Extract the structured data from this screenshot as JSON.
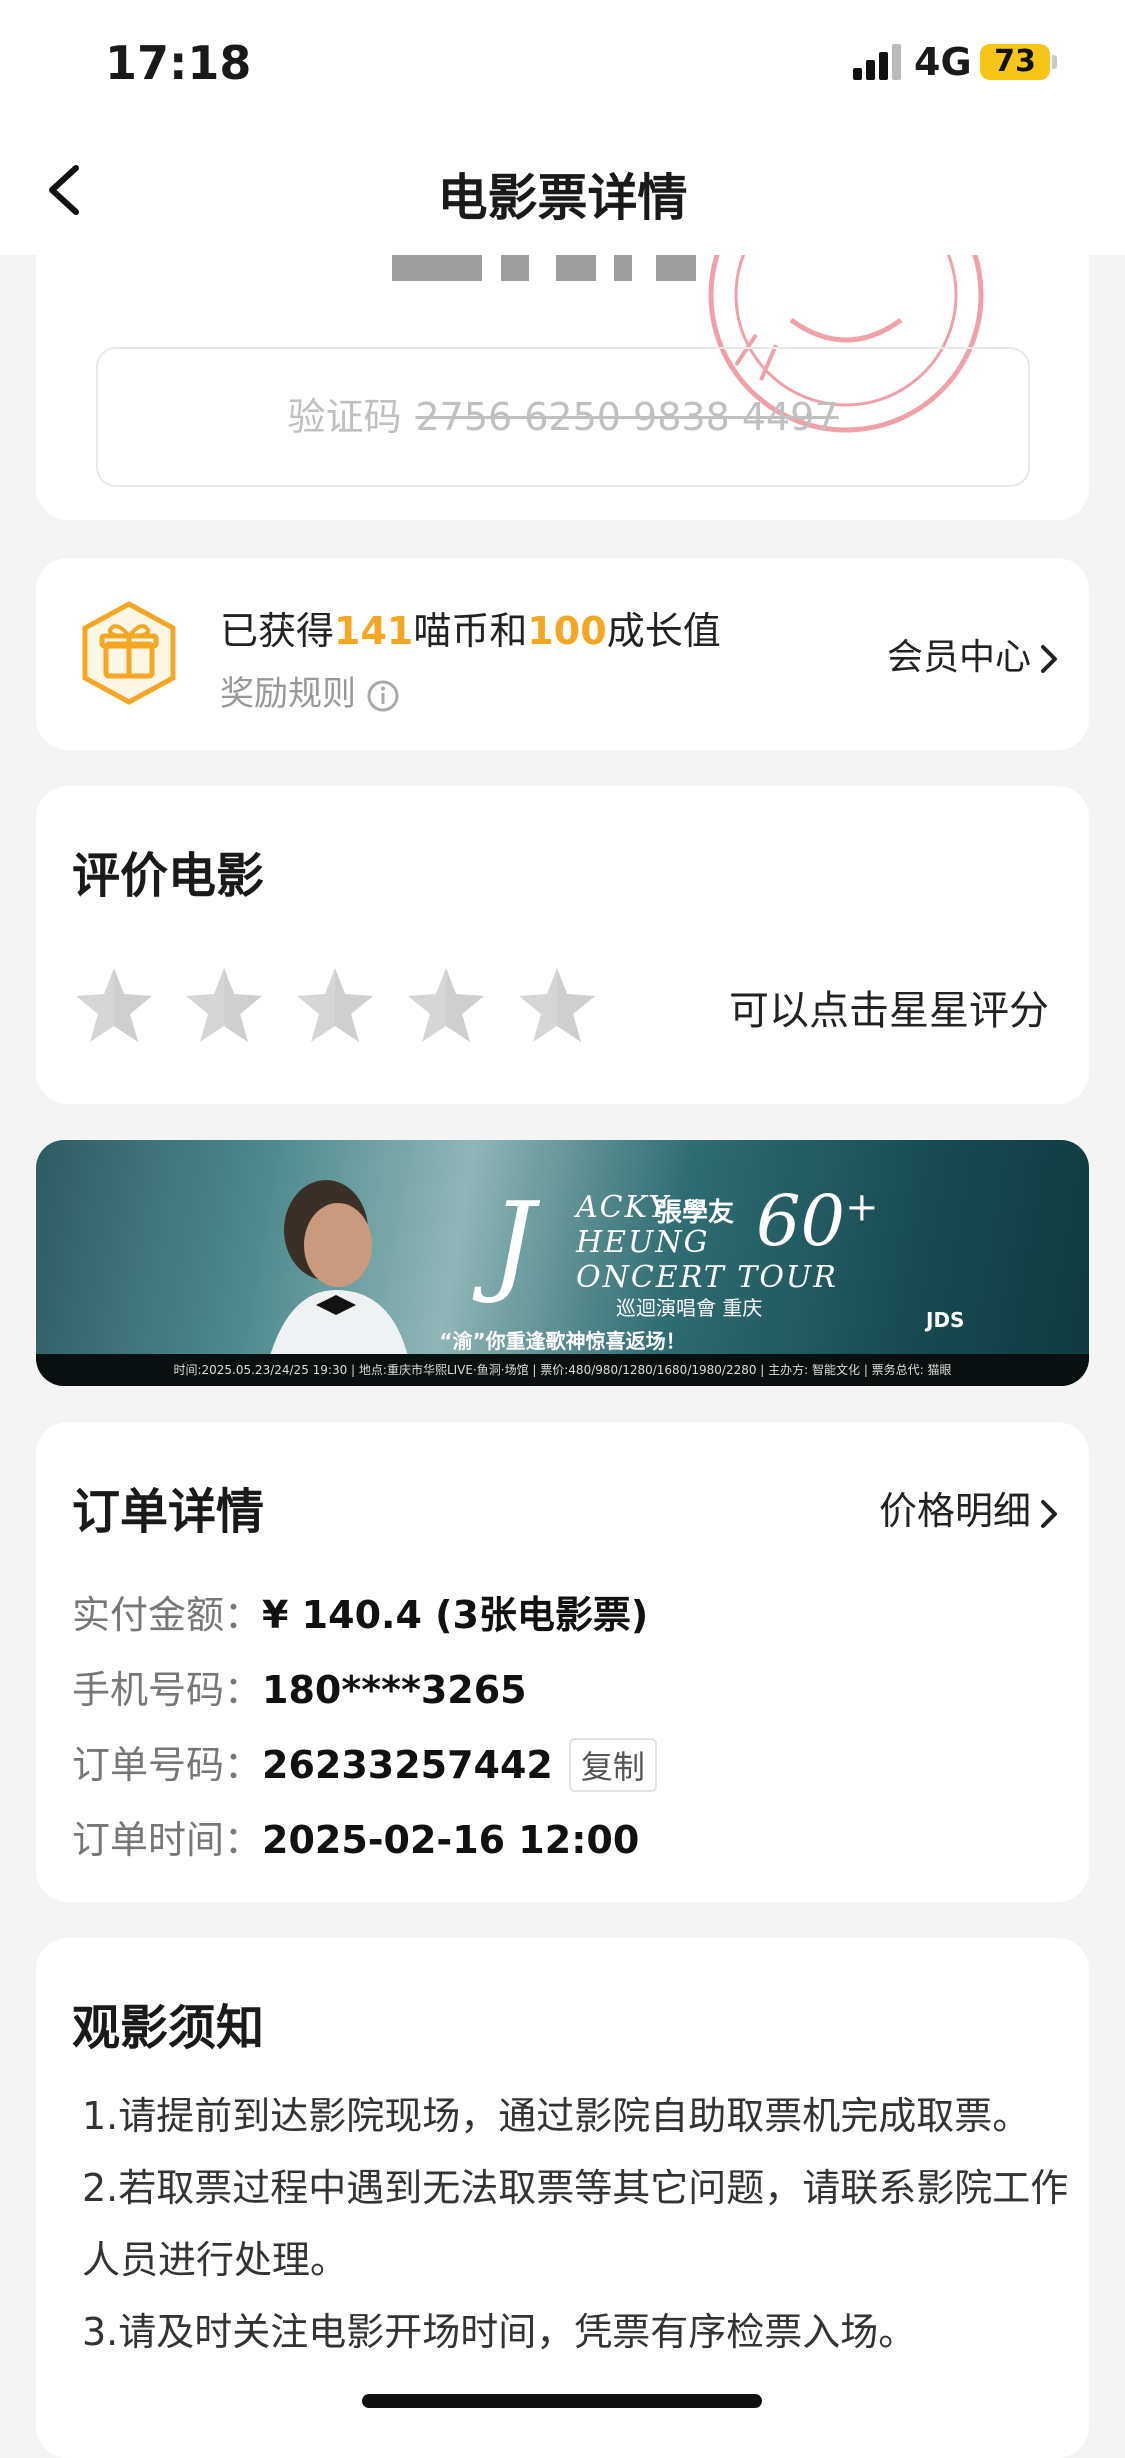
{
  "status_bar": {
    "time": "17:18",
    "network": "4G",
    "battery": "73"
  },
  "nav": {
    "title": "电影票详情",
    "back_icon": "chevron-left-icon"
  },
  "ticket": {
    "verify_label": "验证码",
    "verify_code": "2756 6250 9838 4497"
  },
  "reward": {
    "prefix": "已获得",
    "coins": "141",
    "mid": "喵币和",
    "growth": "100",
    "suffix": "成长值",
    "rules_label": "奖励规则",
    "member_center": "会员中心",
    "accent_color": "#f5a623"
  },
  "rating": {
    "title": "评价电影",
    "hint": "可以点击星星评分",
    "stars_total": 5,
    "stars_selected": 0
  },
  "banner": {
    "big_letter": "J",
    "line1": "ACKY",
    "line2": "HEUNG",
    "line3": "ONCERT TOUR",
    "cn_name": "張學友",
    "number": "60",
    "plus": "+",
    "city": "巡迴演唱會 重庆",
    "slogan": "“渝”你重逢歌神惊喜返场！",
    "brand": "JDS",
    "footer": "时间:2025.05.23/24/25 19:30 | 地点:重庆市华熙LIVE·鱼洞·场馆 | 票价:480/980/1280/1680/1980/2280 | 主办方: 智能文化 | 票务总代: 猫眼"
  },
  "order": {
    "title": "订单详情",
    "price_detail": "价格明细",
    "rows": [
      {
        "label": "实付金额：",
        "value": "¥ 140.4 (3张电影票)"
      },
      {
        "label": "手机号码：",
        "value": "180****3265"
      },
      {
        "label": "订单号码：",
        "value": "26233257442"
      },
      {
        "label": "订单时间：",
        "value": "2025-02-16 12:00"
      }
    ],
    "copy_label": "复制"
  },
  "notice": {
    "title": "观影须知",
    "items": [
      "1.请提前到达影院现场，通过影院自助取票机完成取票。",
      "2.若取票过程中遇到无法取票等其它问题，请联系影院工作人员进行处理。",
      "3.请及时关注电影开场时间，凭票有序检票入场。"
    ]
  }
}
